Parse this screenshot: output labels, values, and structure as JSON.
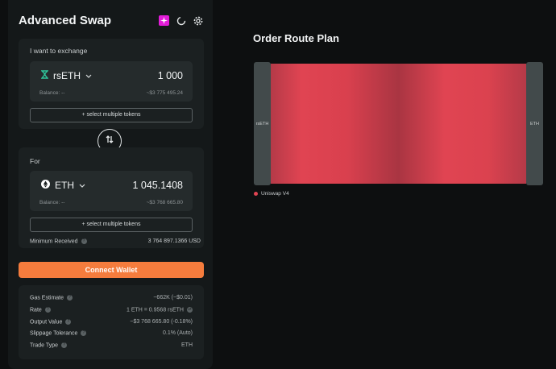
{
  "swap": {
    "title": "Advanced Swap",
    "from": {
      "label": "I want to exchange",
      "token": "rsETH",
      "amount": "1 000",
      "balance": "Balance: --",
      "usd": "~$3 775 495.24",
      "multi_label": "+ select multiple tokens"
    },
    "to": {
      "label": "For",
      "token": "ETH",
      "amount": "1 045.1408",
      "balance": "Balance: --",
      "usd": "~$3 768 665.80",
      "multi_label": "+ select multiple tokens"
    },
    "min_received_label": "Minimum Received",
    "min_received_value": "3 764 897.1366 USD",
    "connect_label": "Connect Wallet",
    "info": [
      {
        "label": "Gas Estimate",
        "value": "~662K (~$0.01)"
      },
      {
        "label": "Rate",
        "value": "1 ETH = 0.9568 rsETH"
      },
      {
        "label": "Output Value",
        "value": "~$3 768 665.80  (-0.18%)"
      },
      {
        "label": "Slippage Tolerance",
        "value": "0.1% (Auto)"
      },
      {
        "label": "Trade Type",
        "value": "ETH"
      }
    ]
  },
  "route": {
    "title": "Order Route Plan",
    "from_node": "rsETH",
    "to_node": "ETH",
    "legend": "Uniswap V4",
    "flow_color": "#e04452"
  },
  "colors": {
    "accent": "#f57c3d",
    "pink": "#e21cd8"
  }
}
